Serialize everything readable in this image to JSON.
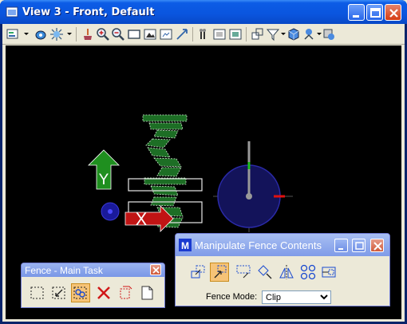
{
  "window": {
    "title": "View 3 - Front, Default",
    "colors": {
      "titlebar": "#0A55DE",
      "viewport_bg": "#000000"
    }
  },
  "toolbar": {
    "icons": [
      "view-attributes-icon",
      "display-style-icon",
      "lighting-icon",
      "update-view-icon",
      "zoom-in-icon",
      "zoom-out-icon",
      "window-area-icon",
      "fit-view-icon",
      "rotate-view-icon",
      "pan-view-icon",
      "view-previous-icon",
      "view-next-icon",
      "copy-view-icon",
      "clip-volume-icon",
      "clip-mask-icon",
      "standard-views-icon",
      "camera-settings-icon",
      "change-view-perspective-icon"
    ]
  },
  "view": {
    "axis_y_label": "Y",
    "axis_x_label": "X"
  },
  "fence_main": {
    "title": "Fence - Main Task",
    "tools": [
      "place-fence-icon",
      "modify-fence-icon",
      "manipulate-fence-contents-icon",
      "delete-fence-contents-icon",
      "drop-fence-icon",
      "file-fence-icon"
    ],
    "active_tool_index": 2
  },
  "manipulate": {
    "title": "Manipulate Fence Contents",
    "tools": [
      "copy-fence-icon",
      "move-fence-icon",
      "scale-fence-icon",
      "rotate-fence-icon",
      "mirror-fence-icon",
      "array-fence-icon",
      "stretch-fence-icon"
    ],
    "active_tool_index": 1,
    "fence_mode_label": "Fence Mode:",
    "fence_mode_value": "Clip",
    "fence_mode_options": [
      "Clip"
    ]
  }
}
